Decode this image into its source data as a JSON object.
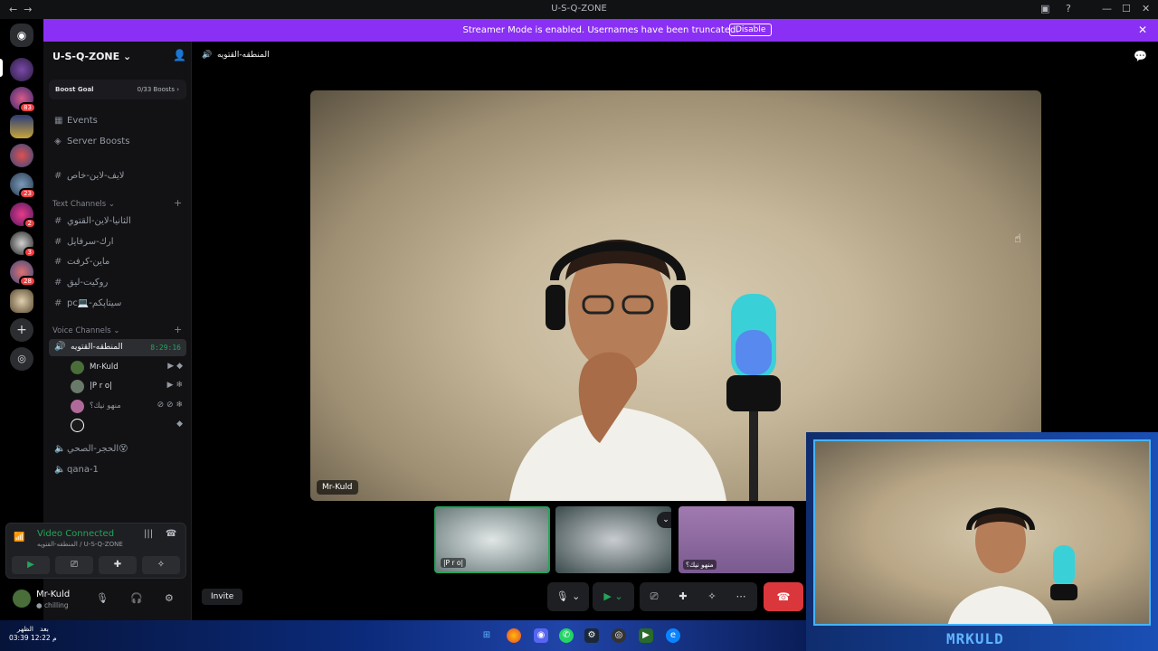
{
  "titlebar": {
    "back": "←",
    "forward": "→",
    "title": "U-S-Q-ZONE"
  },
  "banner": {
    "text": "Streamer Mode is enabled. Usernames have been truncated.",
    "button": "Disable",
    "close": "✕"
  },
  "servers": [
    {
      "badge": ""
    },
    {
      "badge": "83"
    },
    {
      "badge": ""
    },
    {
      "badge": ""
    },
    {
      "badge": "23"
    },
    {
      "badge": "2"
    },
    {
      "badge": "3"
    },
    {
      "badge": "28"
    },
    {
      "badge": ""
    }
  ],
  "sidebar": {
    "guild_name": "U-S-Q-ZONE",
    "boost_label": "Boost Goal",
    "boost_value": "0/33 Boosts",
    "events": "Events",
    "server_boosts": "Server Boosts",
    "top_channel": "لايف-لاين-خاص",
    "text_category": "Text Channels",
    "text_channels": [
      "الثانيا-لاين-القتوي",
      "ارك-سرفايل",
      "ماين-كرفت",
      "روكيت-ليق",
      "pc💻-سيتاپكم"
    ],
    "voice_category": "Voice Channels",
    "active_voice": {
      "name": "المنطقه-القتويه",
      "timer": "8:29:16"
    },
    "members": [
      {
        "name": "Mr-Kuld"
      },
      {
        "name": "|P r o|"
      },
      {
        "name": "منهو نيك؟"
      },
      {
        "name": ""
      }
    ],
    "voice_channels": [
      "الحجر-الصحي😵",
      "qana-1"
    ]
  },
  "voice_panel": {
    "status": "Video Connected",
    "sub": "المنطقه-القتويه / U-S-Q-ZONE"
  },
  "user": {
    "name": "Mr-Kuld",
    "status": "chilling"
  },
  "main": {
    "channel": "المنطقه-القتويه",
    "big_tag": "Mr-Kuld",
    "thumbs": [
      "|P r o|",
      "",
      "منهو نيك؟"
    ],
    "invite": "Invite"
  },
  "cam": {
    "brand": "MRKULD"
  },
  "clock": {
    "l1": "بعد",
    "l2": "الظهر",
    "time1": "03:39",
    "time2": "12:22 م"
  }
}
